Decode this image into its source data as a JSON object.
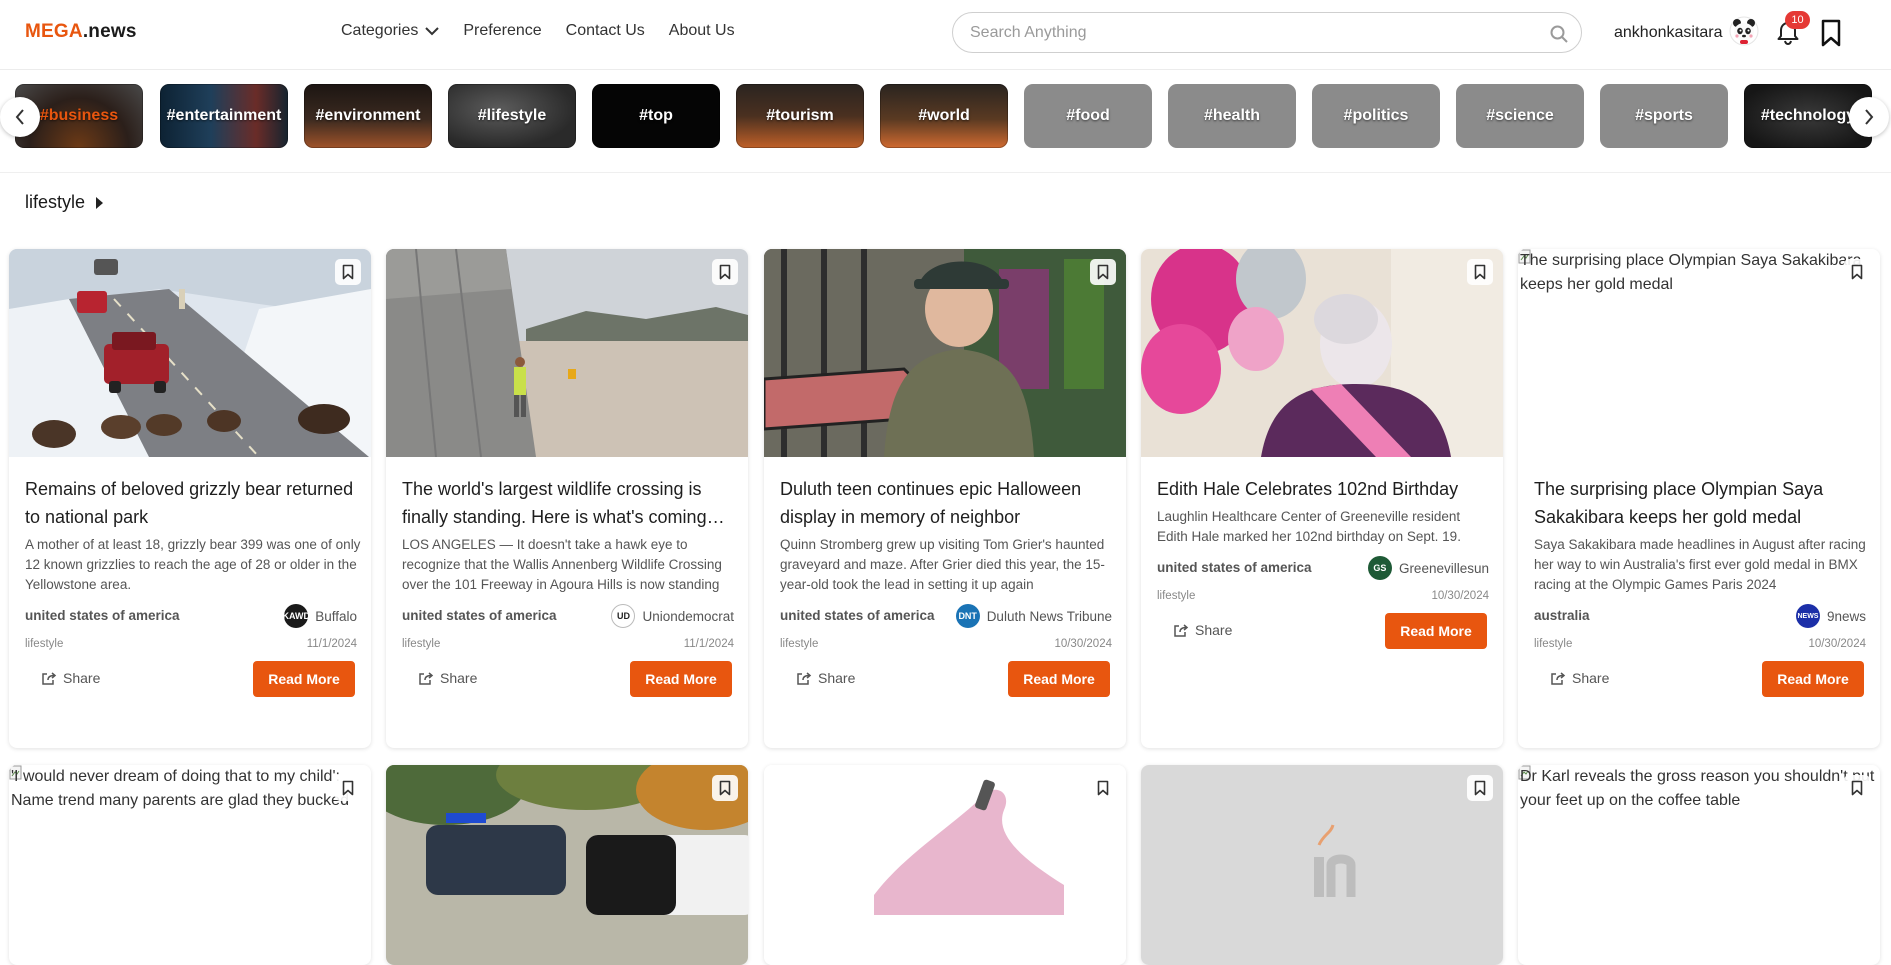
{
  "brand": {
    "part1": "MEGA",
    "part2": ".news"
  },
  "nav": {
    "categories": "Categories",
    "preference": "Preference",
    "contact": "Contact Us",
    "about": "About Us"
  },
  "search": {
    "placeholder": "Search Anything",
    "value": ""
  },
  "user": {
    "name": "ankhonkasitara",
    "notifications": "10"
  },
  "chips": [
    {
      "label": "#business",
      "active": true
    },
    {
      "label": "#entertainment"
    },
    {
      "label": "#environment"
    },
    {
      "label": "#lifestyle"
    },
    {
      "label": "#top"
    },
    {
      "label": "#tourism"
    },
    {
      "label": "#world"
    },
    {
      "label": "#food"
    },
    {
      "label": "#health"
    },
    {
      "label": "#politics"
    },
    {
      "label": "#science"
    },
    {
      "label": "#sports"
    },
    {
      "label": "#technology"
    }
  ],
  "section": {
    "title": "lifestyle"
  },
  "cards": [
    {
      "title": "Remains of beloved grizzly bear returned to national park",
      "desc": "A mother of at least 18, grizzly bear 399 was one of only 12 known grizzlies to reach the age of 28 or older in the Yellowstone area.",
      "country": "united states of america",
      "source": "Buffalo",
      "category": "lifestyle",
      "date": "11/1/2024",
      "share": "Share",
      "read": "Read More"
    },
    {
      "title": "The world's largest wildlife crossing is finally standing. Here is what's coming next",
      "desc": "LOS ANGELES — It doesn't take a hawk eye to recognize that the Wallis Annenberg Wildlife Crossing over the 101 Freeway in Agoura Hills is now standing",
      "country": "united states of america",
      "source": "Uniondemocrat",
      "category": "lifestyle",
      "date": "11/1/2024",
      "share": "Share",
      "read": "Read More"
    },
    {
      "title": "Duluth teen continues epic Halloween display in memory of neighbor",
      "desc": "Quinn Stromberg grew up visiting Tom Grier's haunted graveyard and maze. After Grier died this year, the 15-year-old took the lead in setting it up again",
      "country": "united states of america",
      "source": "Duluth News Tribune",
      "category": "lifestyle",
      "date": "10/30/2024",
      "share": "Share",
      "read": "Read More"
    },
    {
      "title": "Edith Hale Celebrates 102nd Birthday",
      "desc": "Laughlin Healthcare Center of Greeneville resident Edith Hale marked her 102nd birthday on Sept. 19.",
      "country": "united states of america",
      "source": "Greenevillesun",
      "category": "lifestyle",
      "date": "10/30/2024",
      "share": "Share",
      "read": "Read More"
    },
    {
      "title": "The surprising place Olympian Saya Sakakibara keeps her gold medal",
      "alt": "The surprising place Olympian Saya Sakakibara keeps her gold medal",
      "desc": "Saya Sakakibara made headlines in August after racing her way to win Australia's first ever gold medal in BMX racing at the Olympic Games Paris 2024",
      "country": "australia",
      "source": "9news",
      "category": "lifestyle",
      "date": "10/30/2024",
      "share": "Share",
      "read": "Read More"
    }
  ],
  "row2": [
    {
      "alt": "'I would never dream of doing that to my child': Name trend many parents are glad they bucked"
    },
    {
      "alt": ""
    },
    {
      "alt": ""
    },
    {
      "alt": ""
    },
    {
      "alt": "Dr Karl reveals the gross reason you shouldn't put your feet up on the coffee table"
    }
  ],
  "source_icons": {
    "Buffalo": "KAWD",
    "Uniondemocrat": "UD",
    "Duluth News Tribune": "DNT",
    "Greenevillesun": "GS",
    "9news": "NEWS"
  },
  "colors": {
    "accent": "#e8560f",
    "chip_grey": "#8b8b8b",
    "badge": "#e53935"
  }
}
